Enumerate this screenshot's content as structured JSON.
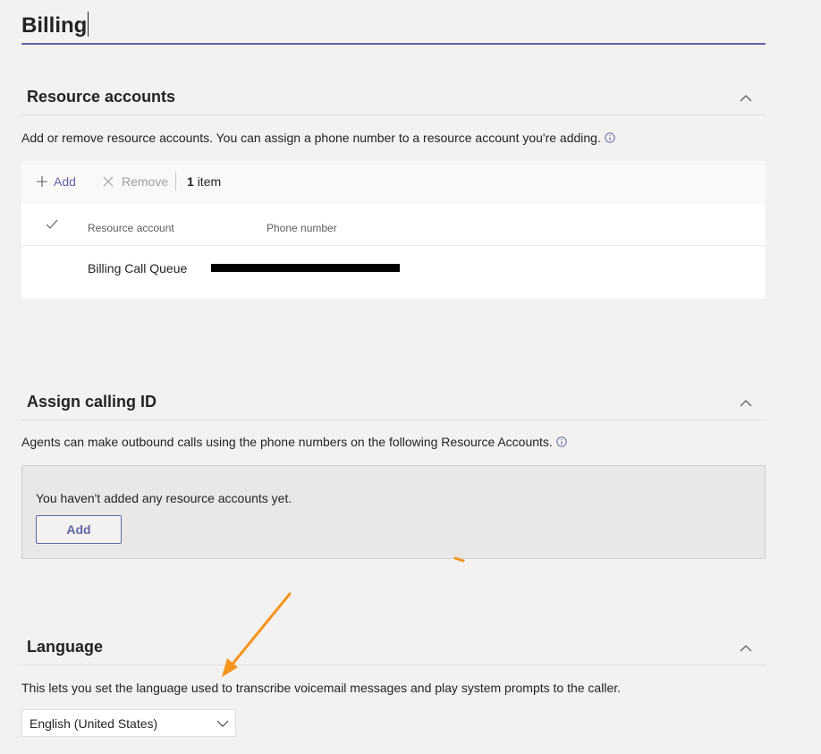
{
  "page": {
    "title": "Billing"
  },
  "resource_accounts": {
    "heading": "Resource accounts",
    "description": "Add or remove resource accounts. You can assign a phone number to a resource account you're adding.",
    "toolbar": {
      "add_label": "Add",
      "remove_label": "Remove",
      "count_number": "1",
      "count_label": "item"
    },
    "table": {
      "columns": [
        "Resource account",
        "Phone number"
      ],
      "rows": [
        {
          "resource_account": "Billing Call Queue",
          "phone_number": ""
        }
      ]
    }
  },
  "calling_id": {
    "heading": "Assign calling ID",
    "description": "Agents can make outbound calls using the phone numbers on the following Resource Accounts.",
    "empty_message": "You haven't added any resource accounts yet.",
    "add_label": "Add"
  },
  "language": {
    "heading": "Language",
    "description": "This lets you set the language used to transcribe voicemail messages and play system prompts to the caller.",
    "selected": "English (United States)"
  },
  "colors": {
    "accent": "#6264a7",
    "annotation": "#f7941d",
    "background": "#f3f2f1"
  },
  "icons": [
    "info-icon",
    "chevron-up-icon",
    "chevron-down-icon",
    "plus-icon",
    "close-icon",
    "checkmark-icon",
    "arrow-annotation"
  ]
}
